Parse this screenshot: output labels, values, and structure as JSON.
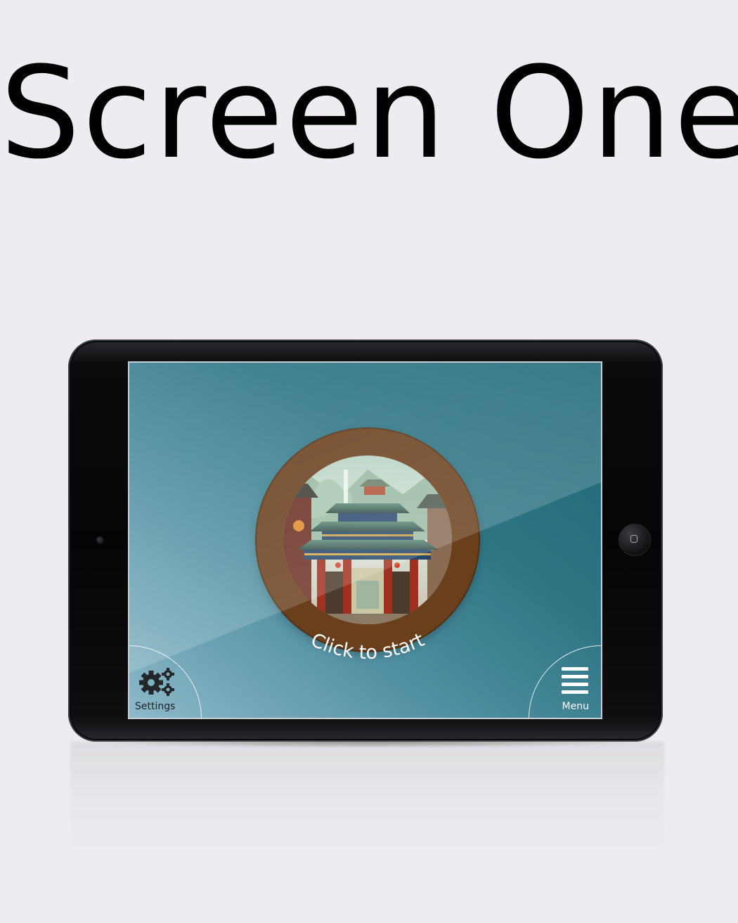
{
  "page": {
    "title": "Screen One"
  },
  "screen": {
    "start_label": "Click to start",
    "settings": {
      "label": "Settings",
      "icon": "gear-icon"
    },
    "menu": {
      "label": "Menu",
      "icon": "hamburger-icon"
    },
    "start_image": "temple-gate-illustration"
  },
  "colors": {
    "page_background": "#eeecf0",
    "screen_top_right": "#1c6675",
    "screen_bottom_left": "#8db9c9",
    "ring": "#6a3f1c",
    "label": "#ffffff"
  }
}
